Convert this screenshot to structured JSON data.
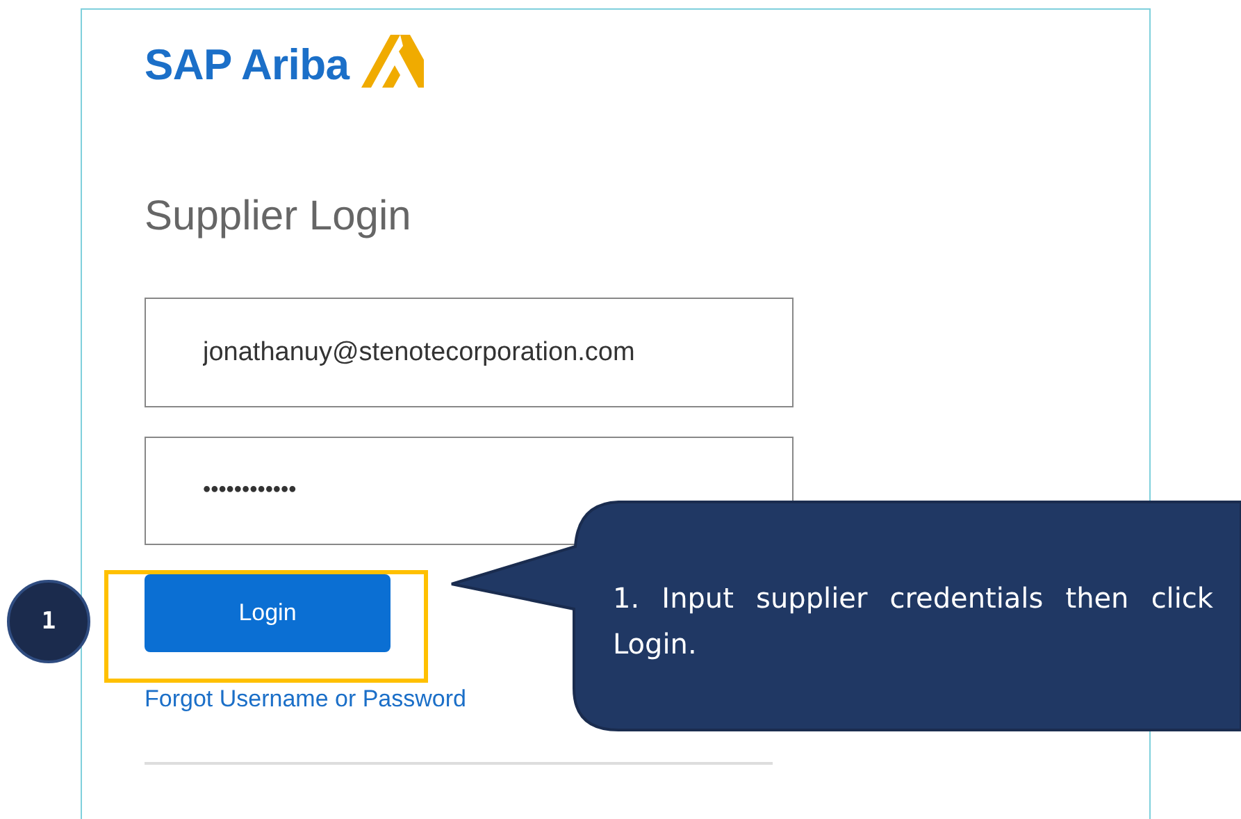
{
  "logo": {
    "text": "SAP Ariba"
  },
  "title": "Supplier Login",
  "email_field": {
    "value": "jonathanuy@stenotecorporation.com"
  },
  "password_field": {
    "value": "••••••••••••"
  },
  "login_button": {
    "label": "Login"
  },
  "forgot_link": "Forgot Username or Password",
  "step_badge": "1",
  "callout": {
    "text": "1. Input supplier credentials then click Login."
  }
}
